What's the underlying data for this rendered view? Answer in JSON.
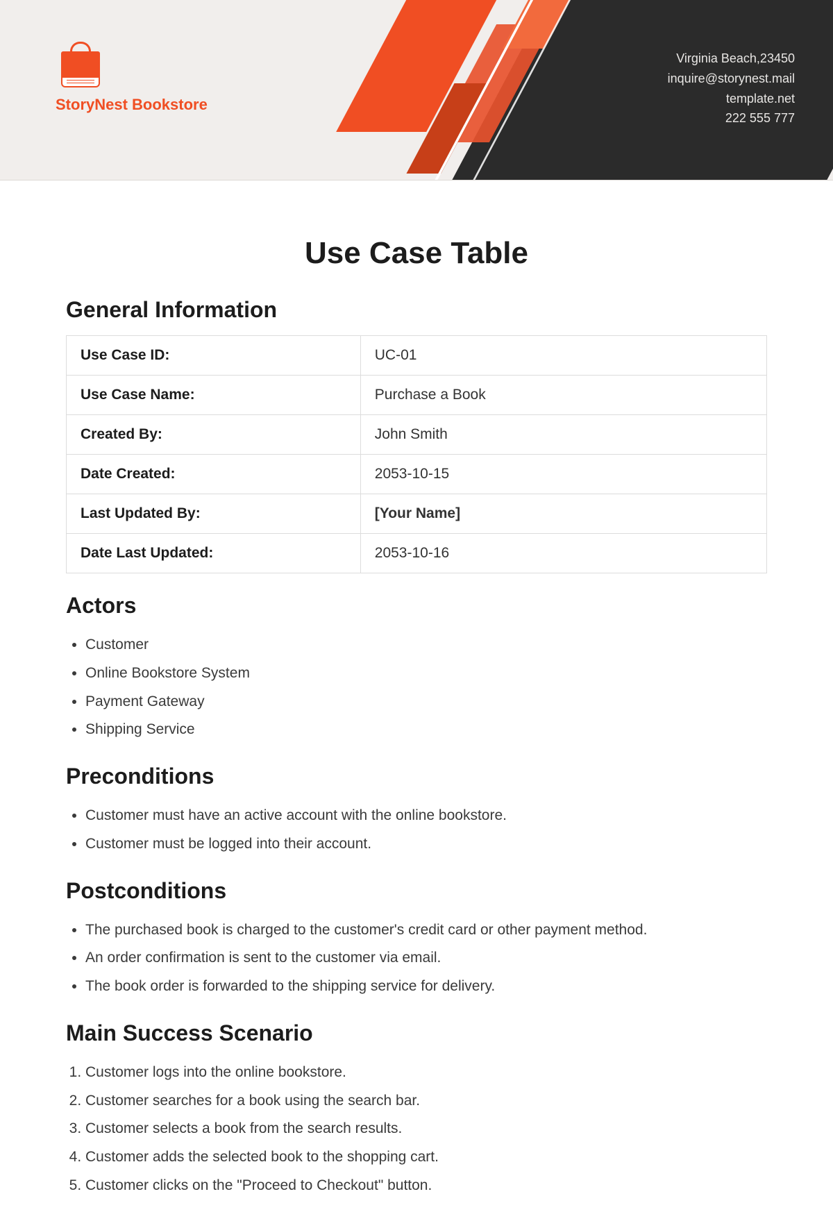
{
  "header": {
    "logo_name": "StoryNest Bookstore",
    "contact": {
      "address": "Virginia Beach,23450",
      "email": "inquire@storynest.mail",
      "site": "template.net",
      "phone": "222 555 777"
    }
  },
  "title": "Use Case Table",
  "sections": {
    "general_info": {
      "heading": "General Information",
      "rows": [
        {
          "key": "Use Case ID:",
          "value": "UC-01"
        },
        {
          "key": "Use Case Name:",
          "value": "Purchase a Book"
        },
        {
          "key": "Created By:",
          "value": "John Smith"
        },
        {
          "key": "Date Created:",
          "value": "2053-10-15"
        },
        {
          "key": "Last Updated By:",
          "value": "[Your Name]",
          "bold": true
        },
        {
          "key": "Date Last Updated:",
          "value": "2053-10-16"
        }
      ]
    },
    "actors": {
      "heading": "Actors",
      "items": [
        "Customer",
        "Online Bookstore System",
        "Payment Gateway",
        "Shipping Service"
      ]
    },
    "preconditions": {
      "heading": "Preconditions",
      "items": [
        "Customer must have an active account with the online bookstore.",
        "Customer must be logged into their account."
      ]
    },
    "postconditions": {
      "heading": "Postconditions",
      "items": [
        "The purchased book is charged to the customer's credit card or other payment method.",
        "An order confirmation is sent to the customer via email.",
        "The book order is forwarded to the shipping service for delivery."
      ]
    },
    "main_success": {
      "heading": "Main Success Scenario",
      "items": [
        "Customer logs into the online bookstore.",
        "Customer searches for a book using the search bar.",
        "Customer selects a book from the search results.",
        "Customer adds the selected book to the shopping cart.",
        "Customer clicks on the \"Proceed to Checkout\" button."
      ]
    }
  }
}
